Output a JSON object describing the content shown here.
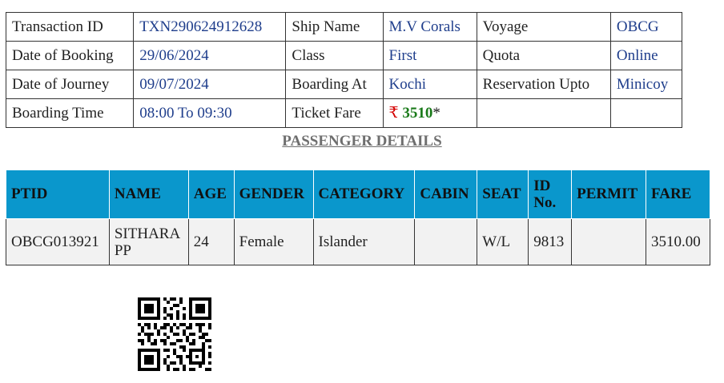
{
  "info": {
    "rows": [
      [
        {
          "label": "Transaction ID",
          "value": "TXN290624912628"
        },
        {
          "label": "Ship Name",
          "value": "M.V Corals"
        },
        {
          "label": "Voyage",
          "value": "OBCG"
        }
      ],
      [
        {
          "label": "Date of Booking",
          "value": "29/06/2024"
        },
        {
          "label": "Class",
          "value": "First"
        },
        {
          "label": "Quota",
          "value": "Online"
        }
      ],
      [
        {
          "label": "Date of Journey",
          "value": "09/07/2024"
        },
        {
          "label": "Boarding At",
          "value": "Kochi"
        },
        {
          "label": "Reservation Upto",
          "value": "Minicoy"
        }
      ]
    ],
    "boarding_time_label": "Boarding Time",
    "boarding_time_value": "08:00 To 09:30",
    "ticket_fare_label": "Ticket Fare",
    "fare_currency": "₹",
    "fare_amount": "3510",
    "fare_suffix": "*"
  },
  "section_title": "PASSENGER DETAILS",
  "passengers": {
    "headers": {
      "ptid": "PTID",
      "name": "NAME",
      "age": "AGE",
      "gender": "GENDER",
      "category": "CATEGORY",
      "cabin": "CABIN",
      "seat": "SEAT",
      "id_no": "ID No.",
      "permit": "PERMIT",
      "fare": "FARE"
    },
    "rows": [
      {
        "ptid": "OBCG013921",
        "name": "SITHARA PP",
        "age": "24",
        "gender": "Female",
        "category": "Islander",
        "cabin": "",
        "seat": "W/L",
        "id_no": "9813",
        "permit": "",
        "fare": "3510.00"
      }
    ]
  },
  "qr_icon": "qr-code-icon",
  "colors": {
    "header_bg": "#0a97cc",
    "value_text": "#1f3e8c",
    "fare_green": "#1a7a1a",
    "rupee_red": "#d40000"
  }
}
